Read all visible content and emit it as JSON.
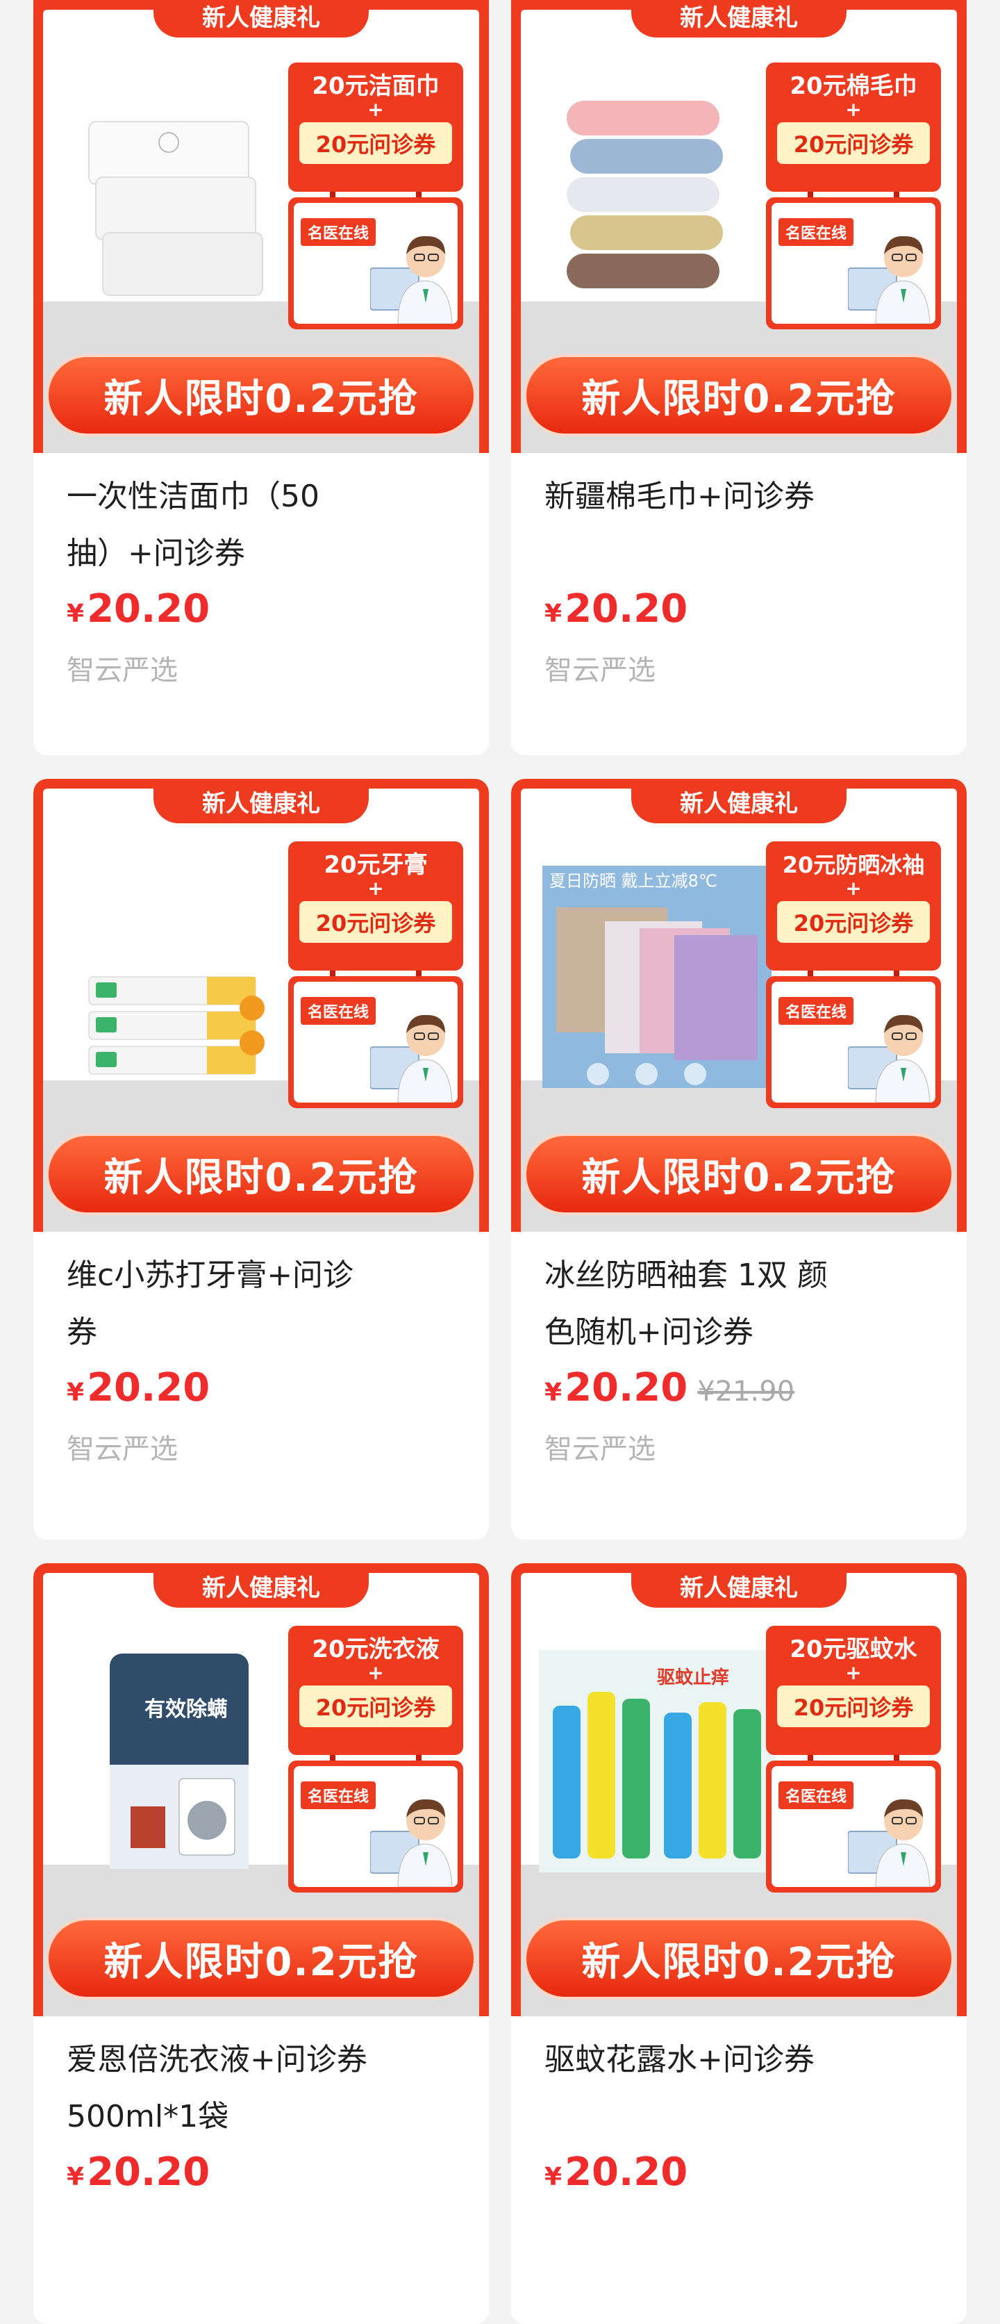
{
  "colors": {
    "accent": "#ee3a1e",
    "price": "#f02b2b",
    "shop": "#b5b5b5"
  },
  "banner_common": {
    "tab_label": "新人健康礼",
    "coupon_label": "20元问诊券",
    "plus": "+",
    "doctor_tag": "名医在线",
    "cta_label": "新人限时0.2元抢"
  },
  "products": [
    {
      "offer_title": "20元洁面巾",
      "title_line1": "一次性洁面巾（50",
      "title_line2": "抽）+问诊券",
      "currency": "¥",
      "price": "20.20",
      "original_price": "",
      "shop": "智云严选",
      "image": "face-towel-packs"
    },
    {
      "offer_title": "20元棉毛巾",
      "title_line1": "新疆棉毛巾+问诊券",
      "title_line2": "",
      "currency": "¥",
      "price": "20.20",
      "original_price": "",
      "shop": "智云严选",
      "image": "cotton-towels"
    },
    {
      "offer_title": "20元牙膏",
      "title_line1": "维c小苏打牙膏+问诊",
      "title_line2": "券",
      "currency": "¥",
      "price": "20.20",
      "original_price": "",
      "shop": "智云严选",
      "image": "toothpaste-tubes"
    },
    {
      "offer_title": "20元防晒冰袖",
      "title_line1": "冰丝防晒袖套 1双 颜",
      "title_line2": "色随机+问诊券",
      "currency": "¥",
      "price": "20.20",
      "original_price": "¥21.90",
      "shop": "智云严选",
      "image": "sun-sleeves",
      "image_text": "夏日防晒 戴上立减8℃"
    },
    {
      "offer_title": "20元洗衣液",
      "title_line1": "爱恩倍洗衣液+问诊券",
      "title_line2": "500ml*1袋",
      "currency": "¥",
      "price": "20.20",
      "original_price": "",
      "shop": "",
      "image": "laundry-pouch",
      "image_text": "有效除螨"
    },
    {
      "offer_title": "20元驱蚊水",
      "title_line1": "驱蚊花露水+问诊券",
      "title_line2": "",
      "currency": "¥",
      "price": "20.20",
      "original_price": "",
      "shop": "",
      "image": "mosquito-spray",
      "image_text": "驱蚊止痒"
    }
  ]
}
